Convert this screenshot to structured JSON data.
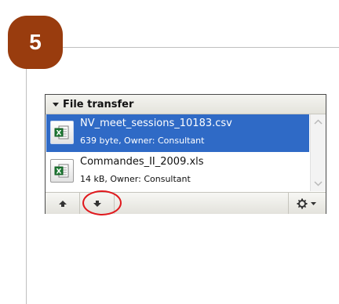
{
  "step": {
    "number": "5"
  },
  "file_transfer": {
    "title": "File transfer",
    "files": [
      {
        "name": "NV_meet_sessions_10183.csv",
        "meta": "639 byte, Owner: Consultant",
        "icon": "excel-file-icon",
        "selected": true
      },
      {
        "name": "Commandes_II_2009.xls",
        "meta": "14 kB, Owner: Consultant",
        "icon": "excel-file-icon",
        "selected": false
      }
    ],
    "toolbar": {
      "buttons": [
        "move-up",
        "move-down",
        "settings"
      ]
    }
  },
  "colors": {
    "step_badge": "#993c0e",
    "selection": "#2f6ac6",
    "highlight_ring": "#e0191e"
  }
}
